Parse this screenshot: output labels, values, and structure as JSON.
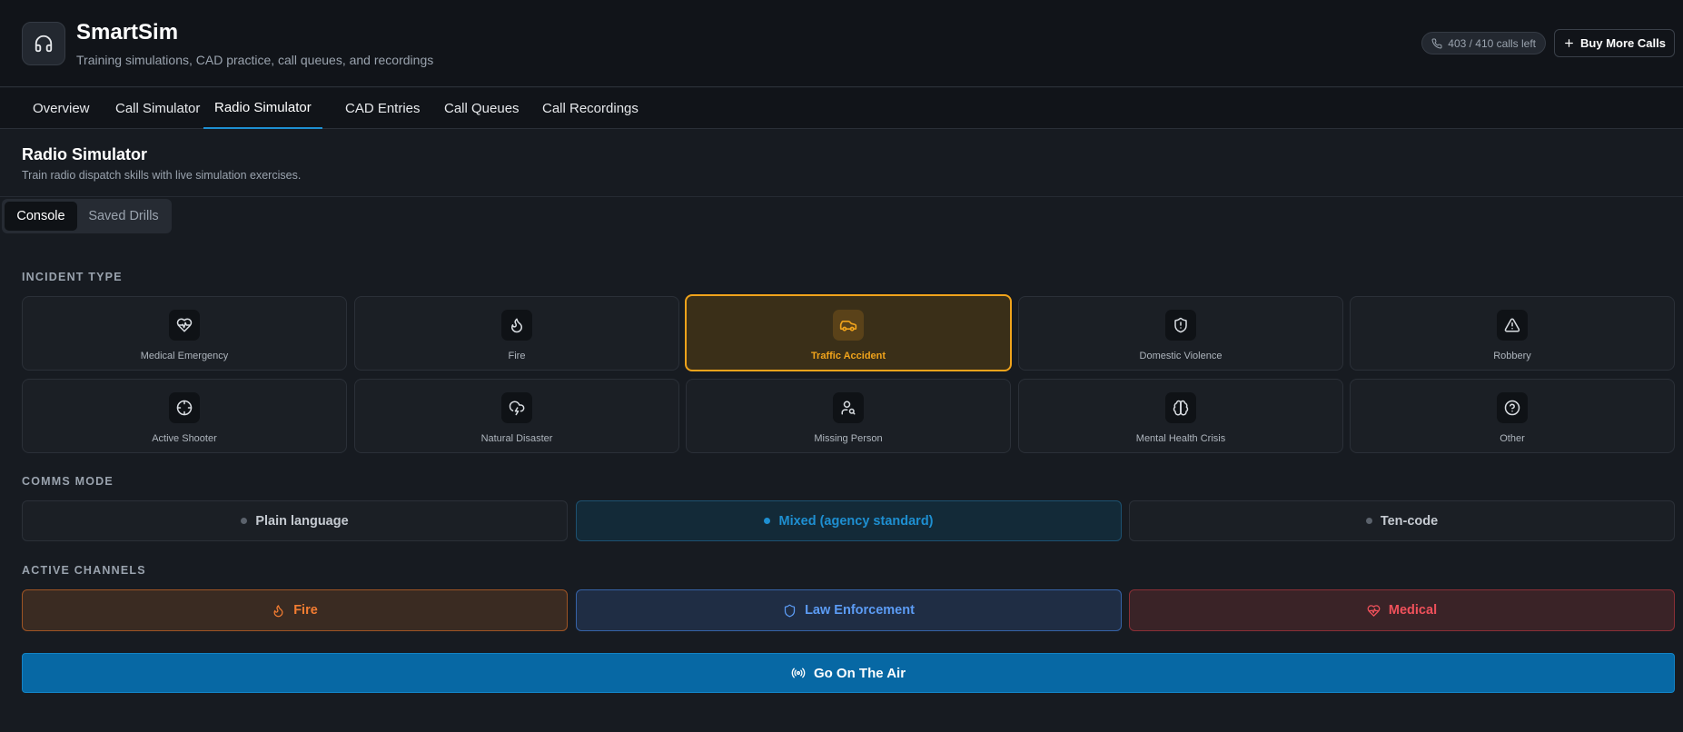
{
  "app": {
    "title": "SmartSim",
    "subtitle": "Training simulations, CAD practice, call queues, and recordings",
    "icon": "headphones-icon"
  },
  "header": {
    "calls_left": "403 / 410 calls left",
    "buy_label": "Buy More Calls"
  },
  "nav": {
    "tabs": [
      {
        "label": "Overview"
      },
      {
        "label": "Call Simulator"
      },
      {
        "label": "Radio Simulator",
        "active": true
      },
      {
        "label": "CAD Entries"
      },
      {
        "label": "Call Queues"
      },
      {
        "label": "Call Recordings"
      }
    ]
  },
  "page": {
    "title": "Radio Simulator",
    "description": "Train radio dispatch skills with live simulation exercises."
  },
  "subtabs": [
    {
      "label": "Console",
      "active": true
    },
    {
      "label": "Saved Drills"
    }
  ],
  "incident": {
    "label": "INCIDENT TYPE",
    "selected": "Traffic Accident",
    "types": [
      {
        "label": "Medical Emergency",
        "icon": "heart-pulse-icon"
      },
      {
        "label": "Fire",
        "icon": "flame-icon"
      },
      {
        "label": "Traffic Accident",
        "icon": "car-icon"
      },
      {
        "label": "Domestic Violence",
        "icon": "shield-alert-icon"
      },
      {
        "label": "Robbery",
        "icon": "warning-triangle-icon"
      },
      {
        "label": "Active Shooter",
        "icon": "crosshair-icon"
      },
      {
        "label": "Natural Disaster",
        "icon": "cloud-lightning-icon"
      },
      {
        "label": "Missing Person",
        "icon": "user-search-icon"
      },
      {
        "label": "Mental Health Crisis",
        "icon": "brain-icon"
      },
      {
        "label": "Other",
        "icon": "help-circle-icon"
      }
    ]
  },
  "comms": {
    "label": "COMMS MODE",
    "selected": "Mixed (agency standard)",
    "modes": [
      {
        "label": "Plain language"
      },
      {
        "label": "Mixed (agency standard)"
      },
      {
        "label": "Ten-code"
      }
    ]
  },
  "channels": {
    "label": "ACTIVE CHANNELS",
    "items": [
      {
        "label": "Fire",
        "icon": "flame-icon",
        "color": "#f47d32"
      },
      {
        "label": "Law Enforcement",
        "icon": "shield-icon",
        "color": "#5c9cf5"
      },
      {
        "label": "Medical",
        "icon": "heart-pulse-icon",
        "color": "#f0515b"
      }
    ]
  },
  "go_button": {
    "label": "Go On The Air",
    "icon": "radio-broadcast-icon"
  },
  "colors": {
    "accent": "#1e8fd1",
    "selected": "#f0a31b",
    "background": "#171b21"
  }
}
